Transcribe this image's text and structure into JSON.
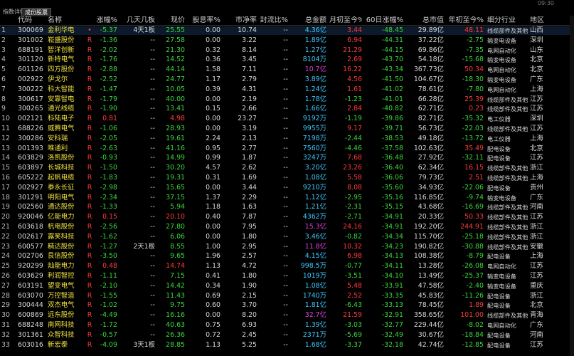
{
  "tabs": [
    "指数详情",
    "成份股票"
  ],
  "clock": "09:30",
  "columns": [
    "代码",
    "名称",
    "涨幅%",
    "几天几板",
    "现价",
    "股息率%",
    "市净率",
    "封流比%",
    "总金额",
    "月初至今%",
    "60日涨幅%",
    "总市值",
    "年初至今%",
    "细分行业",
    "地区"
  ],
  "rows": [
    {
      "i": "1",
      "code": "300069",
      "name": "金利华电",
      "mark": "•",
      "chg": "-5.37",
      "board": "4天1板",
      "price": "25.55",
      "div": "0.00",
      "pb": "10.74",
      "seal": "--",
      "amt": "4.36亿",
      "amtc": "cyan",
      "mtd": "3.44",
      "d60": "-48.45",
      "mcap": "29.89亿",
      "ytd": "48.11",
      "ind": "线缆部件及其他",
      "reg": "山西"
    },
    {
      "i": "2",
      "code": "301002",
      "name": "崧盛股份",
      "mark": "R",
      "chg": "-1.36",
      "board": "--",
      "price": "27.58",
      "div": "0.00",
      "pb": "3.22",
      "seal": "--",
      "amt": "1.89亿",
      "amtc": "cyan",
      "mtd": "6.94",
      "d60": "-44.31",
      "mcap": "37.22亿",
      "ytd": "-2.75",
      "ind": "输变电设备",
      "reg": "深圳"
    },
    {
      "i": "3",
      "code": "688191",
      "name": "智洋创新",
      "mark": "R",
      "chg": "-2.02",
      "board": "--",
      "price": "21.30",
      "div": "0.32",
      "pb": "8.14",
      "seal": "--",
      "amt": "1.27亿",
      "amtc": "cyan",
      "mtd": "21.29",
      "d60": "-44.15",
      "mcap": "69.86亿",
      "ytd": "-7.35",
      "ind": "电网自动化",
      "reg": "山东"
    },
    {
      "i": "4",
      "code": "301120",
      "name": "新特电气",
      "mark": "R",
      "chg": "-1.76",
      "board": "--",
      "price": "14.52",
      "div": "0.36",
      "pb": "3.45",
      "seal": "--",
      "amt": "8104万",
      "amtc": "cyan",
      "mtd": "2.69",
      "d60": "-43.70",
      "mcap": "54.18亿",
      "ytd": "-15.68",
      "ind": "输变电设备",
      "reg": "北京"
    },
    {
      "i": "5",
      "code": "601126",
      "name": "四方股份",
      "mark": "R",
      "chg": "-2.88",
      "board": "--",
      "price": "44.14",
      "div": "1.58",
      "pb": "7.11",
      "seal": "--",
      "amt": "10.7亿",
      "amtc": "magenta",
      "mtd": "16.22",
      "d60": "-43.34",
      "mcap": "367.73亿",
      "ytd": "50.34",
      "ind": "电网自动化",
      "reg": "北京"
    },
    {
      "i": "6",
      "code": "002922",
      "name": "伊戈尔",
      "mark": "R",
      "chg": "-2.52",
      "board": "--",
      "price": "24.77",
      "div": "1.17",
      "pb": "2.79",
      "seal": "--",
      "amt": "3.89亿",
      "amtc": "cyan",
      "mtd": "4.56",
      "d60": "-41.50",
      "mcap": "104.67亿",
      "ytd": "-18.30",
      "ind": "输变电设备",
      "reg": "广东"
    },
    {
      "i": "7",
      "code": "300222",
      "name": "科大智能",
      "mark": "R",
      "chg": "-1.47",
      "board": "--",
      "price": "10.05",
      "div": "0.39",
      "pb": "4.31",
      "seal": "--",
      "amt": "1.24亿",
      "amtc": "cyan",
      "mtd": "1.61",
      "d60": "-41.02",
      "mcap": "78.61亿",
      "ytd": "-7.80",
      "ind": "电网自动化",
      "reg": "上海"
    },
    {
      "i": "8",
      "code": "300617",
      "name": "安靠智电",
      "mark": "R",
      "chg": "-1.79",
      "board": "--",
      "price": "40.00",
      "div": "0.00",
      "pb": "2.19",
      "seal": "--",
      "amt": "1.78亿",
      "amtc": "cyan",
      "mtd": "-1.23",
      "d60": "-41.01",
      "mcap": "66.28亿",
      "ytd": "25.39",
      "ind": "线缆部件及其他",
      "reg": "江苏"
    },
    {
      "i": "9",
      "code": "300265",
      "name": "通光线缆",
      "mark": "R",
      "chg": "-1.90",
      "board": "--",
      "price": "13.41",
      "div": "0.15",
      "pb": "2.66",
      "seal": "--",
      "amt": "1.66亿",
      "amtc": "cyan",
      "mtd": "2.84",
      "d60": "-40.82",
      "mcap": "62.71亿",
      "ytd": "0.23",
      "ind": "线缆部件及其他",
      "reg": "江苏"
    },
    {
      "i": "10",
      "code": "002121",
      "name": "科陆电子",
      "mark": "R",
      "chg": "0.81",
      "board": "--",
      "price": "4.98",
      "div": "0.00",
      "pb": "23.27",
      "seal": "--",
      "amt": "9192万",
      "amtc": "cyan",
      "mtd": "-1.19",
      "d60": "-39.86",
      "mcap": "82.71亿",
      "ytd": "-35.32",
      "ind": "电工仪器",
      "reg": "深圳"
    },
    {
      "i": "11",
      "code": "688226",
      "name": "威腾电气",
      "mark": "R",
      "chg": "-1.06",
      "board": "--",
      "price": "28.93",
      "div": "0.00",
      "pb": "3.19",
      "seal": "--",
      "amt": "9955万",
      "amtc": "cyan",
      "mtd": "9.17",
      "d60": "-39.71",
      "mcap": "56.73亿",
      "ytd": "-22.03",
      "ind": "线缆部件及其他",
      "reg": "江苏"
    },
    {
      "i": "12",
      "code": "300286",
      "name": "安科瑞",
      "mark": "R",
      "chg": "-2.05",
      "board": "--",
      "price": "19.61",
      "div": "2.24",
      "pb": "2.13",
      "seal": "--",
      "amt": "7198万",
      "amtc": "cyan",
      "mtd": "-2.44",
      "d60": "-38.53",
      "mcap": "49.18亿",
      "ytd": "-13.72",
      "ind": "电工仪器",
      "reg": "上海"
    },
    {
      "i": "13",
      "code": "001393",
      "name": "唯通利",
      "mark": "R",
      "chg": "-2.63",
      "board": "--",
      "price": "41.16",
      "div": "0.95",
      "pb": "2.77",
      "seal": "--",
      "amt": "7560万",
      "amtc": "cyan",
      "mtd": "-4.46",
      "d60": "-37.58",
      "mcap": "102.63亿",
      "ytd": "35.49",
      "ind": "配电设备",
      "reg": "北京"
    },
    {
      "i": "14",
      "code": "603829",
      "name": "洛凯股份",
      "mark": "R",
      "chg": "-0.93",
      "board": "--",
      "price": "14.99",
      "div": "0.99",
      "pb": "1.87",
      "seal": "--",
      "amt": "3247万",
      "amtc": "cyan",
      "mtd": "7.68",
      "d60": "-36.48",
      "mcap": "27.92亿",
      "ytd": "-32.11",
      "ind": "配电设备",
      "reg": "江苏"
    },
    {
      "i": "15",
      "code": "603897",
      "name": "长城科技",
      "mark": "R",
      "chg": "-1.50",
      "board": "--",
      "price": "30.20",
      "div": "4.57",
      "pb": "2.62",
      "seal": "--",
      "amt": "3.20亿",
      "amtc": "cyan",
      "mtd": "23.26",
      "d60": "-36.40",
      "mcap": "62.34亿",
      "ytd": "16.15",
      "ind": "线缆部件及其他",
      "reg": "浙江"
    },
    {
      "i": "16",
      "code": "605222",
      "name": "起帆电缆",
      "mark": "R",
      "chg": "-1.83",
      "board": "--",
      "price": "19.31",
      "div": "0.31",
      "pb": "1.69",
      "seal": "--",
      "amt": "1.08亿",
      "amtc": "cyan",
      "mtd": "5.58",
      "d60": "-36.06",
      "mcap": "79.73亿",
      "ytd": "2.51",
      "ind": "线缆部件及其他",
      "reg": "上海"
    },
    {
      "i": "17",
      "code": "002927",
      "name": "泰永长征",
      "mark": "R",
      "chg": "-2.98",
      "board": "--",
      "price": "15.65",
      "div": "0.00",
      "pb": "3.44",
      "seal": "--",
      "amt": "9210万",
      "amtc": "cyan",
      "mtd": "8.08",
      "d60": "-35.60",
      "mcap": "34.93亿",
      "ytd": "-22.06",
      "ind": "配电设备",
      "reg": "贵州"
    },
    {
      "i": "18",
      "code": "301291",
      "name": "明阳电气",
      "mark": "R",
      "chg": "-2.34",
      "board": "--",
      "price": "37.15",
      "div": "1.37",
      "pb": "2.29",
      "seal": "--",
      "amt": "1.12亿",
      "amtc": "cyan",
      "mtd": "-2.95",
      "d60": "-35.16",
      "mcap": "116.85亿",
      "ytd": "-9.74",
      "ind": "输变电设备",
      "reg": "广东"
    },
    {
      "i": "19",
      "code": "002560",
      "name": "通达股份",
      "mark": "R",
      "chg": "-1.33",
      "board": "--",
      "price": "5.94",
      "div": "1.18",
      "pb": "1.63",
      "seal": "--",
      "amt": "1.21亿",
      "amtc": "cyan",
      "mtd": "-2.31",
      "d60": "-35.15",
      "mcap": "43.68亿",
      "ytd": "-16.69",
      "ind": "线缆部件及其他",
      "reg": "河南"
    },
    {
      "i": "20",
      "code": "920046",
      "name": "亿能电力",
      "mark": "R",
      "chg": "0.15",
      "board": "--",
      "price": "20.10",
      "div": "0.40",
      "pb": "7.87",
      "seal": "--",
      "amt": "4362万",
      "amtc": "cyan",
      "mtd": "-2.71",
      "d60": "-34.91",
      "mcap": "20.33亿",
      "ytd": "50.33",
      "ind": "线缆部件及其他",
      "reg": "江苏"
    },
    {
      "i": "21",
      "code": "603618",
      "name": "杭电股份",
      "mark": "R",
      "chg": "-2.56",
      "board": "--",
      "price": "27.80",
      "div": "0.00",
      "pb": "7.95",
      "seal": "--",
      "amt": "15.3亿",
      "amtc": "magenta",
      "mtd": "24.16",
      "d60": "-34.91",
      "mcap": "192.20亿",
      "ytd": "244.91",
      "ind": "线缆部件及其他",
      "reg": "浙江"
    },
    {
      "i": "22",
      "code": "002617",
      "name": "露笑科技",
      "mark": "R",
      "chg": "-1.62",
      "board": "--",
      "price": "6.06",
      "div": "0.00",
      "pb": "1.80",
      "seal": "--",
      "amt": "3.46亿",
      "amtc": "cyan",
      "mtd": "-0.82",
      "d60": "-34.34",
      "mcap": "115.70亿",
      "ytd": "-25.18",
      "ind": "线缆部件及其他",
      "reg": "浙江"
    },
    {
      "i": "23",
      "code": "600577",
      "name": "精达股份",
      "mark": "R",
      "chg": "-1.27",
      "board": "2天1板",
      "price": "8.55",
      "div": "1.00",
      "pb": "2.95",
      "seal": "--",
      "amt": "11.8亿",
      "amtc": "magenta",
      "mtd": "10.32",
      "d60": "-34.23",
      "mcap": "190.82亿",
      "ytd": "-30.88",
      "ind": "线缆部件及其他",
      "reg": "安徽"
    },
    {
      "i": "24",
      "code": "002706",
      "name": "良信股份",
      "mark": "R",
      "chg": "-3.50",
      "board": "--",
      "price": "9.65",
      "div": "1.96",
      "pb": "2.57",
      "seal": "--",
      "amt": "4.15亿",
      "amtc": "cyan",
      "mtd": "6.98",
      "d60": "-34.13",
      "mcap": "108.38亿",
      "ytd": "-8.79",
      "ind": "配电设备",
      "reg": "上海"
    },
    {
      "i": "25",
      "code": "920299",
      "name": "灿能电力",
      "mark": "R",
      "chg": "0.48",
      "board": "--",
      "price": "14.74",
      "div": "1.13",
      "pb": "4.72",
      "seal": "--",
      "amt": "998.5万",
      "amtc": "cyan",
      "mtd": "-0.77",
      "d60": "-34.11",
      "mcap": "13.28亿",
      "ytd": "-26.08",
      "ind": "电网自动化",
      "reg": "江苏"
    },
    {
      "i": "26",
      "code": "603629",
      "name": "利润智控",
      "mark": "R",
      "chg": "-1.11",
      "board": "--",
      "price": "7.15",
      "div": "0.41",
      "pb": "1.80",
      "seal": "--",
      "amt": "1019万",
      "amtc": "cyan",
      "mtd": "-3.51",
      "d60": "-34.10",
      "mcap": "13.49亿",
      "ytd": "-25.37",
      "ind": "输变电设备",
      "reg": "江苏"
    },
    {
      "i": "27",
      "code": "603191",
      "name": "望变电气",
      "mark": "R",
      "chg": "-2.10",
      "board": "--",
      "price": "14.42",
      "div": "0.34",
      "pb": "1.90",
      "seal": "--",
      "amt": "1.08亿",
      "amtc": "cyan",
      "mtd": "5.48",
      "d60": "-33.91",
      "mcap": "47.58亿",
      "ytd": "-2.40",
      "ind": "输变电设备",
      "reg": "重庆"
    },
    {
      "i": "28",
      "code": "603070",
      "name": "万控智造",
      "mark": "R",
      "chg": "-1.55",
      "board": "--",
      "price": "11.43",
      "div": "0.69",
      "pb": "2.15",
      "seal": "--",
      "amt": "1740万",
      "amtc": "cyan",
      "mtd": "2.52",
      "d60": "-33.35",
      "mcap": "45.83亿",
      "ytd": "-11.26",
      "ind": "配电设备",
      "reg": "浙江"
    },
    {
      "i": "29",
      "code": "300444",
      "name": "双杰电气",
      "mark": "R",
      "chg": "-1.02",
      "board": "--",
      "price": "9.75",
      "div": "0.60",
      "pb": "3.70",
      "seal": "--",
      "amt": "1.81亿",
      "amtc": "cyan",
      "mtd": "-6.43",
      "d60": "-33.13",
      "mcap": "78.45亿",
      "ytd": "1.89",
      "ind": "配电设备",
      "reg": "北京"
    },
    {
      "i": "30",
      "code": "600869",
      "name": "远东股份",
      "mark": "R",
      "chg": "-4.49",
      "board": "--",
      "price": "16.16",
      "div": "0.00",
      "pb": "8.20",
      "seal": "--",
      "amt": "32.7亿",
      "amtc": "magenta",
      "mtd": "21.59",
      "d60": "-32.91",
      "mcap": "358.65亿",
      "ytd": "101.00",
      "ind": "线缆部件及其他",
      "reg": "青海"
    },
    {
      "i": "31",
      "code": "688248",
      "name": "南网科技",
      "mark": "R",
      "chg": "-1.72",
      "board": "--",
      "price": "40.63",
      "div": "0.75",
      "pb": "6.93",
      "seal": "--",
      "amt": "1.39亿",
      "amtc": "cyan",
      "mtd": "-3.03",
      "d60": "-32.77",
      "mcap": "229.44亿",
      "ytd": "-8.02",
      "ind": "电网自动化",
      "reg": "广东"
    },
    {
      "i": "32",
      "code": "301361",
      "name": "众智科技",
      "mark": "R",
      "chg": "-0.57",
      "board": "--",
      "price": "26.36",
      "div": "0.72",
      "pb": "2.45",
      "seal": "--",
      "amt": "2371万",
      "amtc": "cyan",
      "mtd": "-5.69",
      "d60": "-32.49",
      "mcap": "30.67亿",
      "ytd": "-18.84",
      "ind": "配电设备",
      "reg": "河南"
    },
    {
      "i": "33",
      "code": "603016",
      "name": "新宏泰",
      "mark": "R",
      "chg": "-4.09",
      "board": "3天1板",
      "price": "28.85",
      "div": "1.13",
      "pb": "5.25",
      "seal": "--",
      "amt": "1.68亿",
      "amtc": "cyan",
      "mtd": "-3.37",
      "d60": "-32.18",
      "mcap": "42.74亿",
      "ytd": "-12.85",
      "ind": "配电设备",
      "reg": "江苏"
    }
  ]
}
